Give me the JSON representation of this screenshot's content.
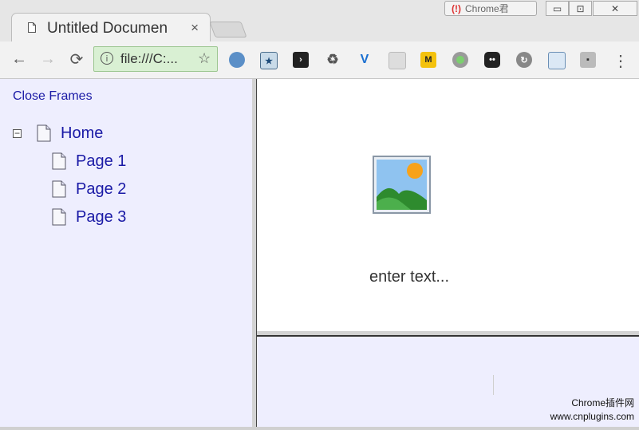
{
  "tab": {
    "title": "Untitled Documen",
    "close": "×"
  },
  "titlebar": {
    "badge": "Chrome君",
    "minimize": "▭",
    "restore": "⊡",
    "close": "✕"
  },
  "toolbar": {
    "back": "←",
    "forward": "→",
    "reload": "⟳",
    "url": "file:///C:...",
    "info_icon": "i",
    "star": "☆",
    "menu": "⋮",
    "extensions": [
      "globe-icon",
      "star-box-icon",
      "code-icon",
      "recycle-icon",
      "v-icon",
      "table-icon",
      "m-icon",
      "dot-icon",
      "face-icon",
      "circle-arrow-icon",
      "window-icon",
      "bag-icon"
    ]
  },
  "left_frame": {
    "close_frames": "Close Frames",
    "tree": [
      {
        "label": "Home",
        "level": 0
      },
      {
        "label": "Page 1",
        "level": 1
      },
      {
        "label": "Page 2",
        "level": 1
      },
      {
        "label": "Page 3",
        "level": 1
      }
    ]
  },
  "right_top": {
    "caption": "enter text..."
  },
  "watermark": {
    "line1": "Chrome插件网",
    "line2": "www.cnplugins.com"
  },
  "colors": {
    "frame_bg": "#eeeefe",
    "link": "#1a1aa6",
    "secure_bg": "#d9f0d3"
  }
}
